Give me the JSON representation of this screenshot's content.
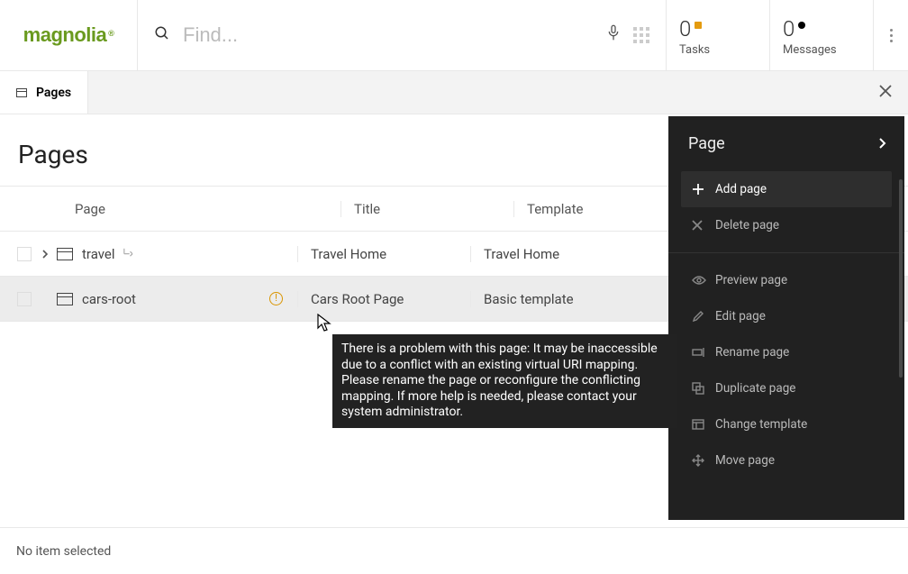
{
  "brand": {
    "name": "magnolia",
    "mark": "®",
    "color": "#6a9a1f"
  },
  "search": {
    "placeholder": "Find..."
  },
  "header": {
    "tasks_count": "0",
    "tasks_label": "Tasks",
    "messages_count": "0",
    "messages_label": "Messages"
  },
  "tab": {
    "label": "Pages"
  },
  "page": {
    "title": "Pages"
  },
  "columns": {
    "page": "Page",
    "title": "Title",
    "template": "Template"
  },
  "rows": [
    {
      "name": "travel",
      "title": "Travel Home",
      "template": "Travel Home",
      "expandable": true,
      "selected": false,
      "warning": false
    },
    {
      "name": "cars-root",
      "title": "Cars Root Page",
      "template": "Basic template",
      "expandable": false,
      "selected": true,
      "warning": true
    }
  ],
  "tooltip": "There is a problem with this page: It may be inaccessible due to a conflict with an existing virtual URI mapping. Please rename the page or reconfigure the conflicting mapping. If more help is needed, please contact your system administrator.",
  "panel": {
    "heading": "Page",
    "actions": [
      {
        "key": "add",
        "label": "Add page",
        "icon": "plus",
        "enabled": true
      },
      {
        "key": "delete",
        "label": "Delete page",
        "icon": "x",
        "enabled": false
      },
      {
        "sep": true
      },
      {
        "key": "preview",
        "label": "Preview page",
        "icon": "eye",
        "enabled": false
      },
      {
        "key": "edit",
        "label": "Edit page",
        "icon": "pencil",
        "enabled": false
      },
      {
        "key": "rename",
        "label": "Rename page",
        "icon": "rename",
        "enabled": false
      },
      {
        "key": "duplicate",
        "label": "Duplicate page",
        "icon": "dup",
        "enabled": false
      },
      {
        "key": "changetpl",
        "label": "Change template",
        "icon": "tpl",
        "enabled": false
      },
      {
        "key": "move",
        "label": "Move page",
        "icon": "move",
        "enabled": false
      }
    ]
  },
  "footer": {
    "status": "No item selected"
  }
}
